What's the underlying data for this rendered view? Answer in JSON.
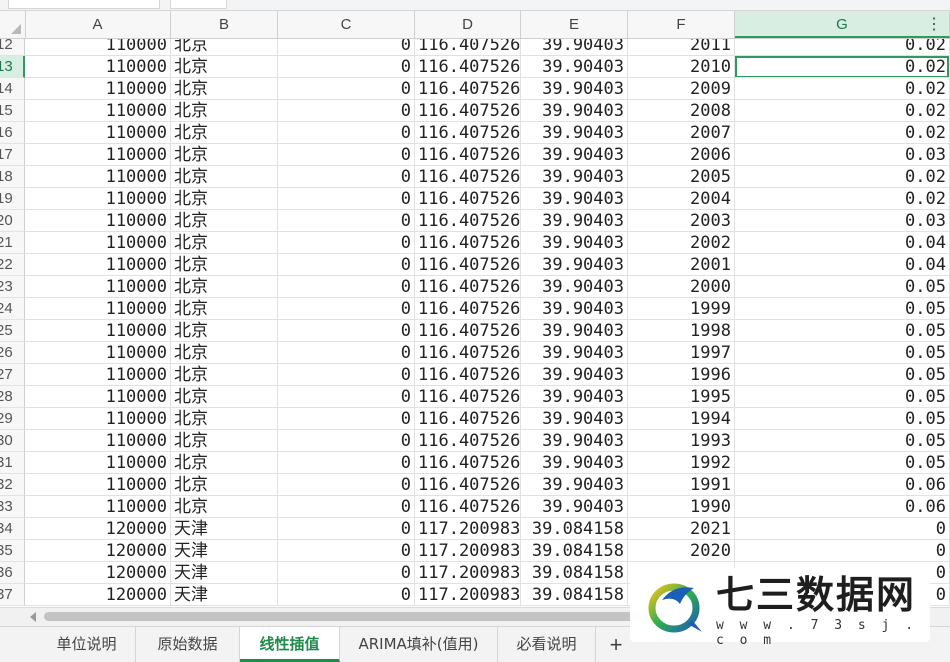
{
  "columns": [
    "A",
    "B",
    "C",
    "D",
    "E",
    "F",
    "G"
  ],
  "active_column": "G",
  "rows": [
    {
      "n": "12",
      "a": "110000",
      "b": "北京",
      "c": "0",
      "d": "116.407526",
      "e": "39.90403",
      "f": "2011",
      "g": "0.02"
    },
    {
      "n": "13",
      "a": "110000",
      "b": "北京",
      "c": "0",
      "d": "116.407526",
      "e": "39.90403",
      "f": "2010",
      "g": "0.02"
    },
    {
      "n": "14",
      "a": "110000",
      "b": "北京",
      "c": "0",
      "d": "116.407526",
      "e": "39.90403",
      "f": "2009",
      "g": "0.02"
    },
    {
      "n": "15",
      "a": "110000",
      "b": "北京",
      "c": "0",
      "d": "116.407526",
      "e": "39.90403",
      "f": "2008",
      "g": "0.02"
    },
    {
      "n": "16",
      "a": "110000",
      "b": "北京",
      "c": "0",
      "d": "116.407526",
      "e": "39.90403",
      "f": "2007",
      "g": "0.02"
    },
    {
      "n": "17",
      "a": "110000",
      "b": "北京",
      "c": "0",
      "d": "116.407526",
      "e": "39.90403",
      "f": "2006",
      "g": "0.03"
    },
    {
      "n": "18",
      "a": "110000",
      "b": "北京",
      "c": "0",
      "d": "116.407526",
      "e": "39.90403",
      "f": "2005",
      "g": "0.02"
    },
    {
      "n": "19",
      "a": "110000",
      "b": "北京",
      "c": "0",
      "d": "116.407526",
      "e": "39.90403",
      "f": "2004",
      "g": "0.02"
    },
    {
      "n": "20",
      "a": "110000",
      "b": "北京",
      "c": "0",
      "d": "116.407526",
      "e": "39.90403",
      "f": "2003",
      "g": "0.03"
    },
    {
      "n": "21",
      "a": "110000",
      "b": "北京",
      "c": "0",
      "d": "116.407526",
      "e": "39.90403",
      "f": "2002",
      "g": "0.04"
    },
    {
      "n": "22",
      "a": "110000",
      "b": "北京",
      "c": "0",
      "d": "116.407526",
      "e": "39.90403",
      "f": "2001",
      "g": "0.04"
    },
    {
      "n": "23",
      "a": "110000",
      "b": "北京",
      "c": "0",
      "d": "116.407526",
      "e": "39.90403",
      "f": "2000",
      "g": "0.05"
    },
    {
      "n": "24",
      "a": "110000",
      "b": "北京",
      "c": "0",
      "d": "116.407526",
      "e": "39.90403",
      "f": "1999",
      "g": "0.05"
    },
    {
      "n": "25",
      "a": "110000",
      "b": "北京",
      "c": "0",
      "d": "116.407526",
      "e": "39.90403",
      "f": "1998",
      "g": "0.05"
    },
    {
      "n": "26",
      "a": "110000",
      "b": "北京",
      "c": "0",
      "d": "116.407526",
      "e": "39.90403",
      "f": "1997",
      "g": "0.05"
    },
    {
      "n": "27",
      "a": "110000",
      "b": "北京",
      "c": "0",
      "d": "116.407526",
      "e": "39.90403",
      "f": "1996",
      "g": "0.05"
    },
    {
      "n": "28",
      "a": "110000",
      "b": "北京",
      "c": "0",
      "d": "116.407526",
      "e": "39.90403",
      "f": "1995",
      "g": "0.05"
    },
    {
      "n": "29",
      "a": "110000",
      "b": "北京",
      "c": "0",
      "d": "116.407526",
      "e": "39.90403",
      "f": "1994",
      "g": "0.05"
    },
    {
      "n": "30",
      "a": "110000",
      "b": "北京",
      "c": "0",
      "d": "116.407526",
      "e": "39.90403",
      "f": "1993",
      "g": "0.05"
    },
    {
      "n": "31",
      "a": "110000",
      "b": "北京",
      "c": "0",
      "d": "116.407526",
      "e": "39.90403",
      "f": "1992",
      "g": "0.05"
    },
    {
      "n": "32",
      "a": "110000",
      "b": "北京",
      "c": "0",
      "d": "116.407526",
      "e": "39.90403",
      "f": "1991",
      "g": "0.06"
    },
    {
      "n": "33",
      "a": "110000",
      "b": "北京",
      "c": "0",
      "d": "116.407526",
      "e": "39.90403",
      "f": "1990",
      "g": "0.06"
    },
    {
      "n": "34",
      "a": "120000",
      "b": "天津",
      "c": "0",
      "d": "117.200983",
      "e": "39.084158",
      "f": "2021",
      "g": "0"
    },
    {
      "n": "35",
      "a": "120000",
      "b": "天津",
      "c": "0",
      "d": "117.200983",
      "e": "39.084158",
      "f": "2020",
      "g": "0"
    },
    {
      "n": "36",
      "a": "120000",
      "b": "天津",
      "c": "0",
      "d": "117.200983",
      "e": "39.084158",
      "f": "",
      "g": "0"
    },
    {
      "n": "37",
      "a": "120000",
      "b": "天津",
      "c": "0",
      "d": "117.200983",
      "e": "39.084158",
      "f": "",
      "g": "0"
    }
  ],
  "active_row": "13",
  "sheet_tabs": [
    "单位说明",
    "原始数据",
    "线性插值",
    "ARIMA填补(值用)",
    "必看说明"
  ],
  "active_tab": "线性插值",
  "add_tab_symbol": "+",
  "header_menu_symbol": "⋮",
  "watermark": {
    "brand": "七三数据网",
    "url": "w w w . 7 3 s j . c o m"
  },
  "colors": {
    "accent": "#1f8a4c",
    "selection": "#2f9a5c",
    "header_active_bg": "#d9eee3"
  }
}
